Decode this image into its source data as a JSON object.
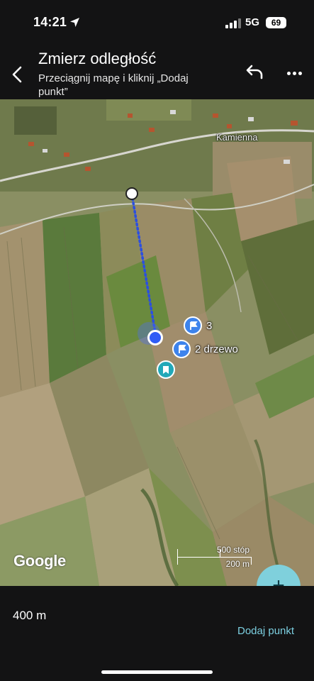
{
  "status": {
    "time": "14:21",
    "network": "5G",
    "battery": "69"
  },
  "header": {
    "title": "Zmierz odległość",
    "subtitle": "Przeciągnij mapę i kliknij „Dodaj punkt”"
  },
  "map": {
    "place_label": "Kamienna",
    "pins": [
      {
        "label": "3"
      },
      {
        "label": "2 drzewo"
      }
    ],
    "attribution": "Google",
    "scale_imperial": "500 stóp",
    "scale_metric": "200 m"
  },
  "fab": {
    "label": "+"
  },
  "footer": {
    "distance": "400 m",
    "add_point_label": "Dodaj punkt"
  },
  "icons": {
    "back": "arrow-left-icon",
    "undo": "undo-icon",
    "more": "more-horizontal-icon",
    "location": "location-arrow-icon",
    "flag": "flag-icon",
    "bookmark": "bookmark-icon"
  },
  "colors": {
    "pin": "#3d83ec",
    "path": "#2b4fe0",
    "fab": "#7fd0dc",
    "accent_text": "#7ccfe0",
    "saved_place": "#21a8b8"
  }
}
